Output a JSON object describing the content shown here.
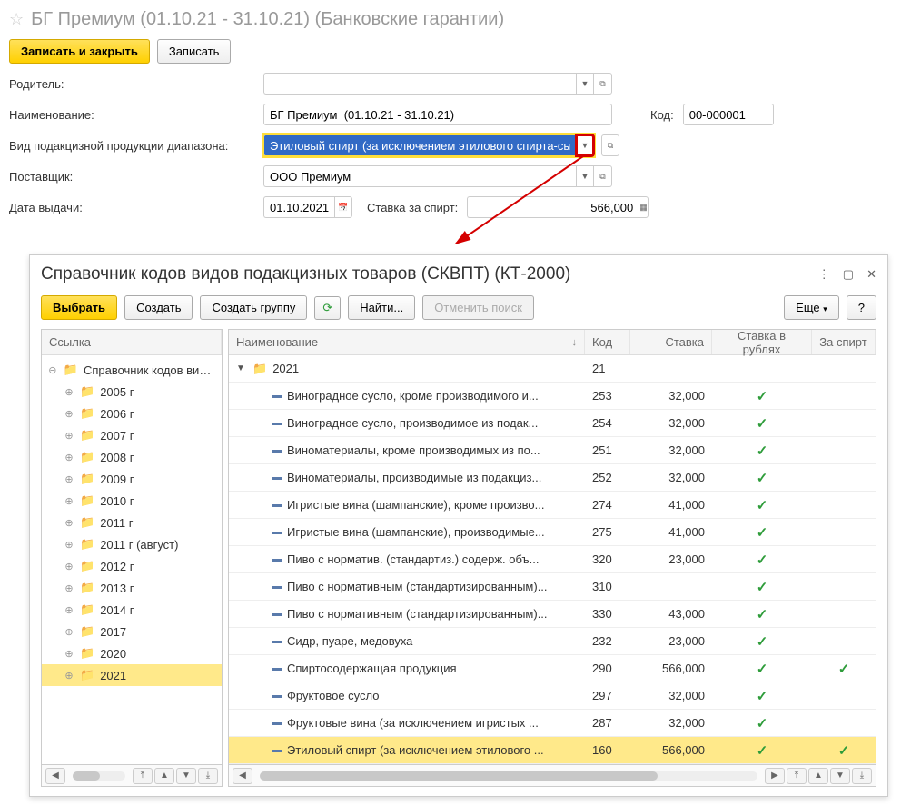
{
  "header": {
    "title": "БГ Премиум  (01.10.21 - 31.10.21) (Банковские гарантии)"
  },
  "toolbar": {
    "save_close": "Записать и закрыть",
    "save": "Записать"
  },
  "form": {
    "parent_label": "Родитель:",
    "parent_value": "",
    "name_label": "Наименование:",
    "name_value": "БГ Премиум  (01.10.21 - 31.10.21)",
    "code_label": "Код:",
    "code_value": "00-000001",
    "product_type_label": "Вид подакцизной продукции диапазона:",
    "product_type_value": "Этиловый спирт (за исключением этилового спирта-сырца,",
    "supplier_label": "Поставщик:",
    "supplier_value": "ООО Премиум",
    "issue_date_label": "Дата выдачи:",
    "issue_date_value": "01.10.2021",
    "spirit_rate_label": "Ставка за спирт:",
    "spirit_rate_value": "566,000"
  },
  "dialog": {
    "title": "Справочник кодов видов подакцизных товаров (СКВПТ) (КТ-2000)",
    "buttons": {
      "select": "Выбрать",
      "create": "Создать",
      "create_group": "Создать группу",
      "find": "Найти...",
      "cancel_search": "Отменить поиск",
      "more": "Еще",
      "help": "?"
    },
    "left": {
      "header": "Ссылка",
      "root": "Справочник кодов видов",
      "years": [
        "2005 г",
        "2006 г",
        "2007 г",
        "2008 г",
        "2009 г",
        "2010 г",
        "2011 г",
        "2011 г (август)",
        "2012 г",
        "2013 г",
        "2014 г",
        "2017",
        "2020",
        "2021"
      ]
    },
    "right": {
      "headers": {
        "name": "Наименование",
        "code": "Код",
        "rate": "Ставка",
        "rubles": "Ставка в рублях",
        "spirit": "За спирт"
      },
      "group": {
        "name": "2021",
        "code": "21"
      },
      "rows": [
        {
          "name": "Виноградное сусло, кроме производимого и...",
          "code": "253",
          "rate": "32,000",
          "rubles": true,
          "spirit": false
        },
        {
          "name": "Виноградное сусло, производимое из подак...",
          "code": "254",
          "rate": "32,000",
          "rubles": true,
          "spirit": false
        },
        {
          "name": "Виноматериалы, кроме производимых из по...",
          "code": "251",
          "rate": "32,000",
          "rubles": true,
          "spirit": false
        },
        {
          "name": "Виноматериалы, производимые из подакциз...",
          "code": "252",
          "rate": "32,000",
          "rubles": true,
          "spirit": false
        },
        {
          "name": "Игристые вина (шампанские), кроме произво...",
          "code": "274",
          "rate": "41,000",
          "rubles": true,
          "spirit": false
        },
        {
          "name": "Игристые вина (шампанские), производимые...",
          "code": "275",
          "rate": "41,000",
          "rubles": true,
          "spirit": false
        },
        {
          "name": "Пиво с норматив. (стандартиз.) содерж. объ...",
          "code": "320",
          "rate": "23,000",
          "rubles": true,
          "spirit": false
        },
        {
          "name": "Пиво с нормативным (стандартизированным)...",
          "code": "310",
          "rate": "",
          "rubles": true,
          "spirit": false
        },
        {
          "name": "Пиво с нормативным (стандартизированным)...",
          "code": "330",
          "rate": "43,000",
          "rubles": true,
          "spirit": false
        },
        {
          "name": "Сидр, пуаре, медовуха",
          "code": "232",
          "rate": "23,000",
          "rubles": true,
          "spirit": false
        },
        {
          "name": "Спиртосодержащая продукция",
          "code": "290",
          "rate": "566,000",
          "rubles": true,
          "spirit": true
        },
        {
          "name": "Фруктовое сусло",
          "code": "297",
          "rate": "32,000",
          "rubles": true,
          "spirit": false
        },
        {
          "name": "Фруктовые вина (за исключением игристых ...",
          "code": "287",
          "rate": "32,000",
          "rubles": true,
          "spirit": false
        },
        {
          "name": "Этиловый спирт (за исключением этилового ...",
          "code": "160",
          "rate": "566,000",
          "rubles": true,
          "spirit": true
        }
      ]
    }
  }
}
